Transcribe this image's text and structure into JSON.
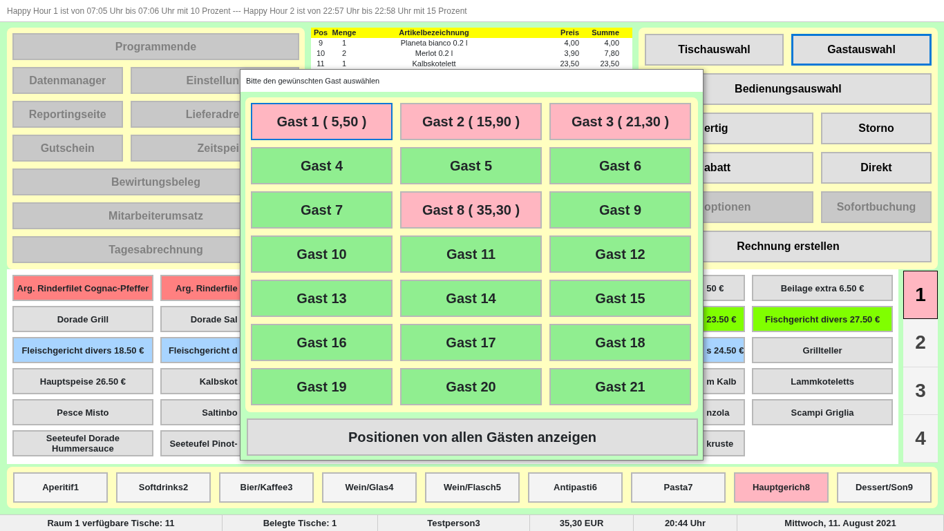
{
  "header_text": "Happy Hour 1 ist von 07:05 Uhr bis 07:06 Uhr mit 10 Prozent --- Happy Hour 2 ist von 22:57 Uhr bis 22:58 Uhr mit 15 Prozent",
  "left_panel": {
    "rows": [
      [
        {
          "label": "Programmende",
          "disabled": true
        }
      ],
      [
        {
          "label": "Datenmanager",
          "disabled": true
        },
        {
          "label": "Einstellun",
          "disabled": true
        }
      ],
      [
        {
          "label": "Reportingseite",
          "disabled": true
        },
        {
          "label": "Lieferadre",
          "disabled": true
        }
      ],
      [
        {
          "label": "Gutschein",
          "disabled": true
        },
        {
          "label": "Zeitspei",
          "disabled": true
        }
      ],
      [
        {
          "label": "Bewirtungsbeleg",
          "disabled": true
        }
      ],
      [
        {
          "label": "Mitarbeiterumsatz",
          "disabled": true
        }
      ],
      [
        {
          "label": "Tagesabrechnung",
          "disabled": true
        }
      ]
    ]
  },
  "order_table": {
    "columns": [
      "Pos",
      "Menge",
      "Artikelbezeichnung",
      "Preis",
      "Summe"
    ],
    "rows": [
      [
        "9",
        "1",
        "Planeta bianco 0.2 l",
        "4,00",
        "4,00"
      ],
      [
        "10",
        "2",
        "Merlot 0.2 l",
        "3,90",
        "7,80"
      ],
      [
        "11",
        "1",
        "Kalbskotelett",
        "23,50",
        "23,50"
      ]
    ]
  },
  "right_panel": {
    "rows": [
      [
        {
          "label": "Tischauswahl",
          "disabled": false,
          "focused": false
        },
        {
          "label": "Gastauswahl",
          "disabled": false,
          "focused": true
        }
      ],
      [
        {
          "label": "Bedienungsauswahl",
          "disabled": false,
          "focused": false
        }
      ],
      [
        {
          "label": "ertig",
          "disabled": false,
          "focused": false
        },
        {
          "label": "Storno",
          "disabled": false,
          "focused": false
        }
      ],
      [
        {
          "label": "abatt",
          "disabled": false,
          "focused": false
        },
        {
          "label": "Direkt",
          "disabled": false,
          "focused": false
        }
      ],
      [
        {
          "label": "optionen",
          "disabled": true,
          "focused": false
        },
        {
          "label": "Sofortbuchung",
          "disabled": true,
          "focused": false
        }
      ],
      [
        {
          "label": "Rechnung erstellen",
          "disabled": false,
          "focused": false
        }
      ]
    ]
  },
  "products": {
    "columns": [
      {
        "items": [
          {
            "label": "Arg. Rinderfilet Cognac-Pfeffer",
            "color": "#ff8080"
          },
          {
            "label": "Dorade Grill",
            "color": "#e0e0e0"
          },
          {
            "label": "Fleischgericht divers 18.50 €",
            "color": "#a8d4ff"
          },
          {
            "label": "Hauptspeise 26.50 €",
            "color": "#e0e0e0"
          },
          {
            "label": "Pesce Misto",
            "color": "#e0e0e0"
          },
          {
            "label": "Seeteufel Dorade Hummersauce",
            "color": "#e0e0e0"
          }
        ]
      },
      {
        "items": [
          {
            "label": "Arg. Rinderfile",
            "color": "#ff8080"
          },
          {
            "label": "Dorade Sal",
            "color": "#e0e0e0"
          },
          {
            "label": "Fleischgericht d",
            "color": "#a8d4ff"
          },
          {
            "label": "Kalbskot",
            "color": "#e0e0e0"
          },
          {
            "label": "Saltinbo",
            "color": "#e0e0e0"
          },
          {
            "label": "Seeteufel Pinot-",
            "color": "#e0e0e0"
          }
        ]
      },
      {
        "items": [
          {
            "label": "50 €",
            "color": "#e0e0e0"
          },
          {
            "label": "23.50 €",
            "color": "#80ff00"
          },
          {
            "label": "s 24.50 €",
            "color": "#a8d4ff"
          },
          {
            "label": "m Kalb",
            "color": "#e0e0e0"
          },
          {
            "label": "nzola",
            "color": "#e0e0e0"
          },
          {
            "label": "kruste",
            "color": "#e0e0e0"
          }
        ]
      },
      {
        "items": [
          {
            "label": "Beilage extra 6.50 €",
            "color": "#e0e0e0"
          },
          {
            "label": "Fischgericht divers 27.50 €",
            "color": "#80ff00"
          },
          {
            "label": "Grillteller",
            "color": "#e0e0e0"
          },
          {
            "label": "Lammkoteletts",
            "color": "#e0e0e0"
          },
          {
            "label": "Scampi Griglia",
            "color": "#e0e0e0"
          }
        ]
      }
    ]
  },
  "pages": [
    {
      "label": "1",
      "selected": true
    },
    {
      "label": "2",
      "selected": false
    },
    {
      "label": "3",
      "selected": false
    },
    {
      "label": "4",
      "selected": false
    }
  ],
  "categories": [
    {
      "label": "Aperitif1",
      "selected": false
    },
    {
      "label": "Softdrinks2",
      "selected": false
    },
    {
      "label": "Bier/Kaffee3",
      "selected": false
    },
    {
      "label": "Wein/Glas4",
      "selected": false
    },
    {
      "label": "Wein/Flasch5",
      "selected": false
    },
    {
      "label": "Antipasti6",
      "selected": false
    },
    {
      "label": "Pasta7",
      "selected": false
    },
    {
      "label": "Hauptgerich8",
      "selected": true
    },
    {
      "label": "Dessert/Son9",
      "selected": false
    }
  ],
  "status_bar": [
    "Raum 1 verfügbare Tische: 11",
    "Belegte Tische: 1",
    "Testperson3",
    "35,30 EUR",
    "20:44 Uhr",
    "Mittwoch, 11. August 2021"
  ],
  "dialog": {
    "title": "Bitte den gewünschten Gast auswählen",
    "guests": [
      {
        "label": "Gast 1 ( 5,50 )",
        "occupied": true,
        "focused": true
      },
      {
        "label": "Gast 2 ( 15,90 )",
        "occupied": true,
        "focused": false
      },
      {
        "label": "Gast 3 ( 21,30 )",
        "occupied": true,
        "focused": false
      },
      {
        "label": "Gast 4",
        "occupied": false,
        "focused": false
      },
      {
        "label": "Gast 5",
        "occupied": false,
        "focused": false
      },
      {
        "label": "Gast 6",
        "occupied": false,
        "focused": false
      },
      {
        "label": "Gast 7",
        "occupied": false,
        "focused": false
      },
      {
        "label": "Gast 8 ( 35,30 )",
        "occupied": true,
        "focused": false
      },
      {
        "label": "Gast 9",
        "occupied": false,
        "focused": false
      },
      {
        "label": "Gast 10",
        "occupied": false,
        "focused": false
      },
      {
        "label": "Gast 11",
        "occupied": false,
        "focused": false
      },
      {
        "label": "Gast 12",
        "occupied": false,
        "focused": false
      },
      {
        "label": "Gast 13",
        "occupied": false,
        "focused": false
      },
      {
        "label": "Gast 14",
        "occupied": false,
        "focused": false
      },
      {
        "label": "Gast 15",
        "occupied": false,
        "focused": false
      },
      {
        "label": "Gast 16",
        "occupied": false,
        "focused": false
      },
      {
        "label": "Gast 17",
        "occupied": false,
        "focused": false
      },
      {
        "label": "Gast 18",
        "occupied": false,
        "focused": false
      },
      {
        "label": "Gast 19",
        "occupied": false,
        "focused": false
      },
      {
        "label": "Gast 20",
        "occupied": false,
        "focused": false
      },
      {
        "label": "Gast 21",
        "occupied": false,
        "focused": false
      }
    ],
    "show_all_button": "Positionen von allen Gästen anzeigen"
  }
}
